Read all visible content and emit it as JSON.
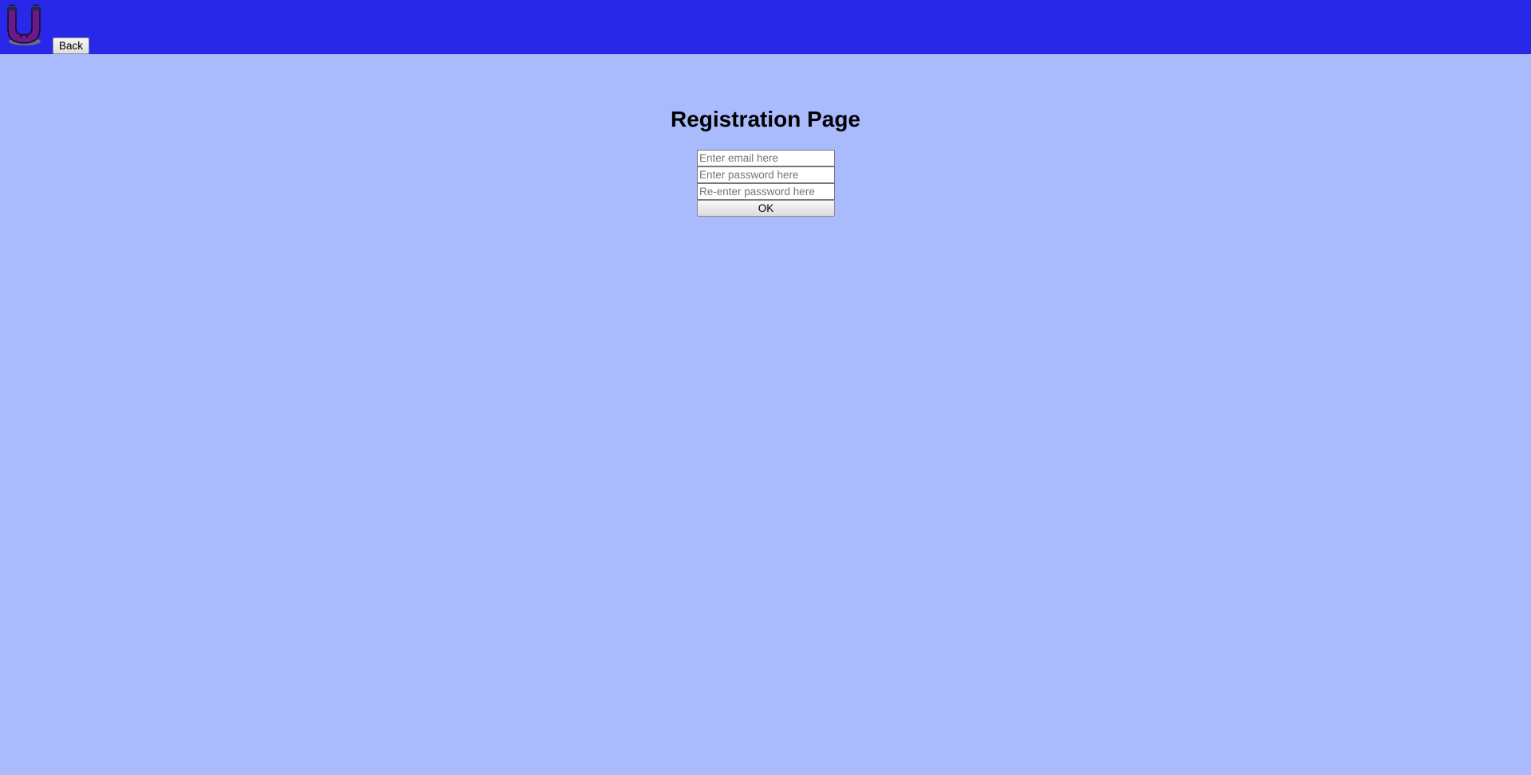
{
  "header": {
    "logo_icon": "magnet-u-logo-icon",
    "back_label": "Back",
    "background_color": "#2828e8"
  },
  "page": {
    "background_color": "#aabbfd",
    "title": "Registration Page"
  },
  "form": {
    "email_placeholder": "Enter email here",
    "password_placeholder": "Enter password here",
    "reenter_placeholder": "Re-enter password here",
    "email_value": "",
    "password_value": "",
    "reenter_value": "",
    "ok_label": "OK"
  }
}
